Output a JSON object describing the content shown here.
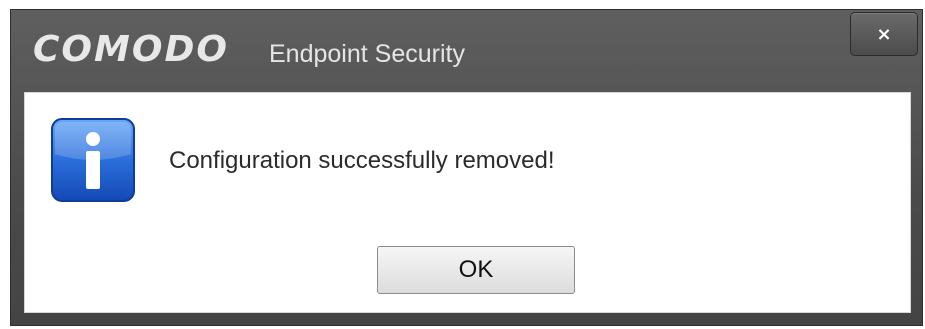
{
  "window": {
    "brand": "COMODO",
    "product": "Endpoint Security",
    "close_label": "×"
  },
  "dialog": {
    "icon": "info-icon",
    "message": "Configuration successfully removed!",
    "ok_label": "OK"
  },
  "colors": {
    "titlebar": "#4f4f4f",
    "icon_blue": "#1e5fcf",
    "content_bg": "#ffffff"
  }
}
